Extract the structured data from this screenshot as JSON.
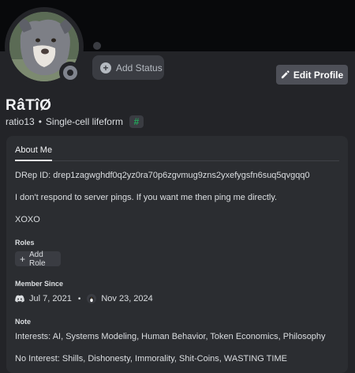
{
  "profile": {
    "display_name": "RâTîØ",
    "username": "ratio13",
    "separator": "•",
    "pronoun_status": "Single-cell lifeform",
    "badge_glyph": "#"
  },
  "header": {
    "add_status_label": "Add Status",
    "edit_profile_label": "Edit Profile"
  },
  "tabs": [
    {
      "label": "About Me",
      "active": true
    }
  ],
  "about": {
    "lines": [
      "DRep ID: drep1zagwghdf0q2yz0ra70p6zgvmug9zns2yxefygsfn6suq5qvgqq0",
      "I don't respond to server pings. If you want me then ping me directly.",
      "XOXO"
    ]
  },
  "roles": {
    "heading": "Roles",
    "add_label": "Add Role"
  },
  "member_since": {
    "heading": "Member Since",
    "discord_date": "Jul 7, 2021",
    "separator": "•",
    "server_date": "Nov 23, 2024"
  },
  "note": {
    "heading": "Note",
    "lines": [
      "Interests: AI, Systems Modeling, Human Behavior, Token Economics, Philosophy",
      "No Interest: Shills, Dishonesty, Immorality, Shit-Coins, WASTING TIME"
    ]
  },
  "colors": {
    "background": "#232428",
    "banner": "#08090b",
    "card": "#2b2d31",
    "button": "#4e5058",
    "hash_badge": "#23a55a",
    "status_offline": "#80848e"
  }
}
